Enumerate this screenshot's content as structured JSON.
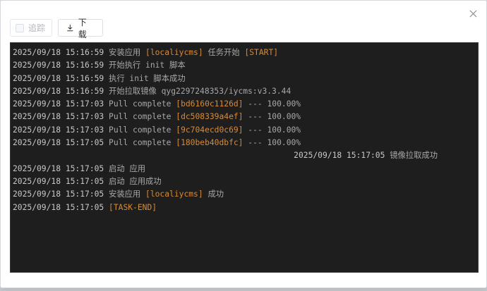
{
  "toolbar": {
    "follow_label": "追踪",
    "download_label": "下载"
  },
  "icons": {
    "close": "close-icon",
    "download": "download-icon"
  },
  "colors": {
    "console_bg": "#1e1e1e",
    "highlight": "#d98a33",
    "text": "#a6a8ab"
  },
  "log": [
    {
      "ts": "2025/09/18 15:16:59",
      "parts": [
        {
          "t": " 安装应用 "
        },
        {
          "t": "[localiycms]",
          "hl": true
        },
        {
          "t": " 任务开始 "
        },
        {
          "t": "[START]",
          "hl": true
        }
      ]
    },
    {
      "ts": "2025/09/18 15:16:59",
      "parts": [
        {
          "t": " 开始执行 init 脚本"
        }
      ]
    },
    {
      "ts": "2025/09/18 15:16:59",
      "parts": [
        {
          "t": " 执行 init 脚本成功"
        }
      ]
    },
    {
      "ts": "2025/09/18 15:16:59",
      "parts": [
        {
          "t": " 开始拉取镜像 qyg2297248353/iycms:v3.3.44"
        }
      ]
    },
    {
      "ts": "2025/09/18 15:17:03",
      "parts": [
        {
          "t": " Pull complete "
        },
        {
          "t": "[bd6160c1126d]",
          "hl": true
        },
        {
          "t": " --- 100.00%"
        }
      ]
    },
    {
      "ts": "2025/09/18 15:17:03",
      "parts": [
        {
          "t": " Pull complete "
        },
        {
          "t": "[dc508339a4ef]",
          "hl": true
        },
        {
          "t": " --- 100.00%"
        }
      ]
    },
    {
      "ts": "2025/09/18 15:17:03",
      "parts": [
        {
          "t": " Pull complete "
        },
        {
          "t": "[9c704ecd0c69]",
          "hl": true
        },
        {
          "t": " --- 100.00%"
        }
      ]
    },
    {
      "ts": "2025/09/18 15:17:05",
      "parts": [
        {
          "t": " Pull complete "
        },
        {
          "t": "[180beb40dbfc]",
          "hl": true
        },
        {
          "t": " --- 100.00%"
        }
      ]
    },
    {
      "ts": "2025/09/18 15:17:05",
      "right": true,
      "parts": [
        {
          "t": " 镜像拉取成功"
        }
      ]
    },
    {
      "ts": "2025/09/18 15:17:05",
      "parts": [
        {
          "t": " 启动 应用"
        }
      ]
    },
    {
      "ts": "2025/09/18 15:17:05",
      "parts": [
        {
          "t": " 启动 应用成功"
        }
      ]
    },
    {
      "ts": "2025/09/18 15:17:05",
      "parts": [
        {
          "t": " 安装应用 "
        },
        {
          "t": "[localiycms]",
          "hl": true
        },
        {
          "t": " 成功"
        }
      ]
    },
    {
      "ts": "2025/09/18 15:17:05",
      "parts": [
        {
          "t": " "
        },
        {
          "t": "[TASK-END]",
          "hl": true
        }
      ]
    }
  ]
}
